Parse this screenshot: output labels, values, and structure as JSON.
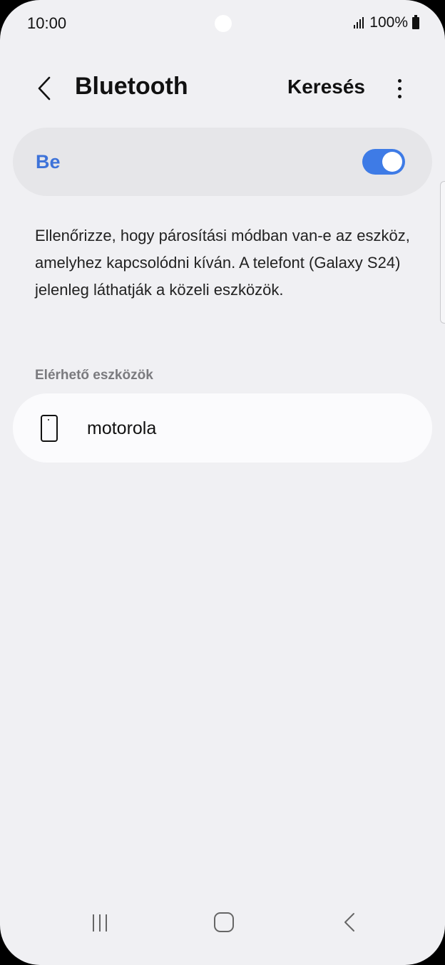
{
  "status_bar": {
    "time": "10:00",
    "battery_text": "100%",
    "icons": [
      "signal-icon",
      "battery-icon"
    ]
  },
  "header": {
    "back_icon": "chevron-left-icon",
    "title": "Bluetooth",
    "search_label": "Keresés",
    "more_icon": "more-vertical-icon"
  },
  "bluetooth_toggle": {
    "label": "Be",
    "state": "on",
    "accent_color": "#3e7be6"
  },
  "description": "Ellenőrizze, hogy párosítási módban van-e az eszköz, amelyhez kapcsolódni kíván. A telefont (Galaxy S24) jelenleg láthatják a közeli eszközök.",
  "available_devices": {
    "section_title": "Elérhető eszközök",
    "items": [
      {
        "name": "motorola",
        "icon": "phone-icon"
      }
    ]
  },
  "nav_bar": {
    "icons": [
      "recent-apps-icon",
      "home-icon",
      "back-icon"
    ]
  }
}
